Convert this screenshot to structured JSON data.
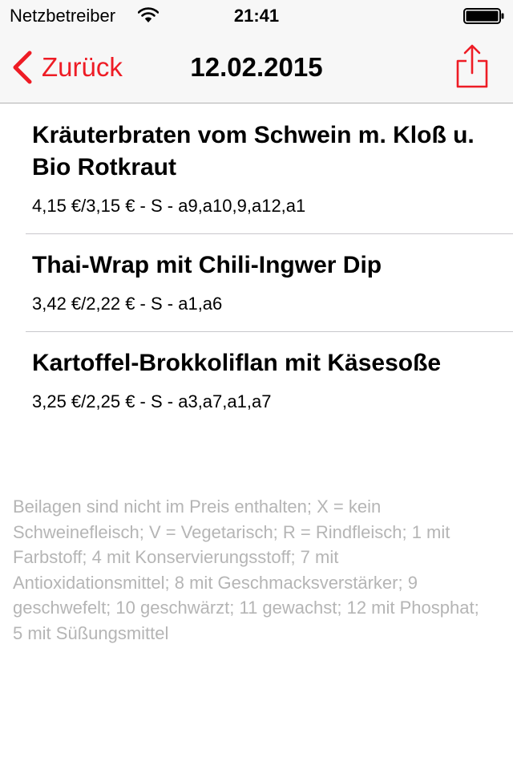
{
  "status_bar": {
    "carrier": "Netzbetreiber",
    "time": "21:41",
    "wifi_icon": "wifi-icon",
    "battery_icon": "battery-full-icon"
  },
  "nav": {
    "back_label": "Zurück",
    "title": "12.02.2015",
    "back_icon": "chevron-left-icon",
    "share_icon": "share-icon",
    "accent_color": "#ee1c25"
  },
  "menu": {
    "items": [
      {
        "name": "Kräuterbraten vom Schwein  m. Kloß  u. Bio Rotkraut",
        "price": "4,15 €/3,15 € - S - a9,a10,9,a12,a1"
      },
      {
        "name": "Thai-Wrap mit Chili-Ingwer Dip",
        "price": "3,42 €/2,22 € - S - a1,a6"
      },
      {
        "name": "Kartoffel-Brokkoliflan  mit Käsesoße",
        "price": "3,25 €/2,25 € - S - a3,a7,a1,a7"
      }
    ]
  },
  "footnote": "Beilagen sind nicht im Preis enthalten; X = kein Schweinefleisch; V = Vegetarisch; R = Rindfleisch; 1 mit Farbstoff; 4 mit Konservierungsstoff; 7 mit Antioxidationsmittel; 8 mit Geschmacksverstärker; 9 geschwefelt; 10 geschwärzt; 11 gewachst; 12 mit Phosphat; 5 mit Süßungsmittel"
}
